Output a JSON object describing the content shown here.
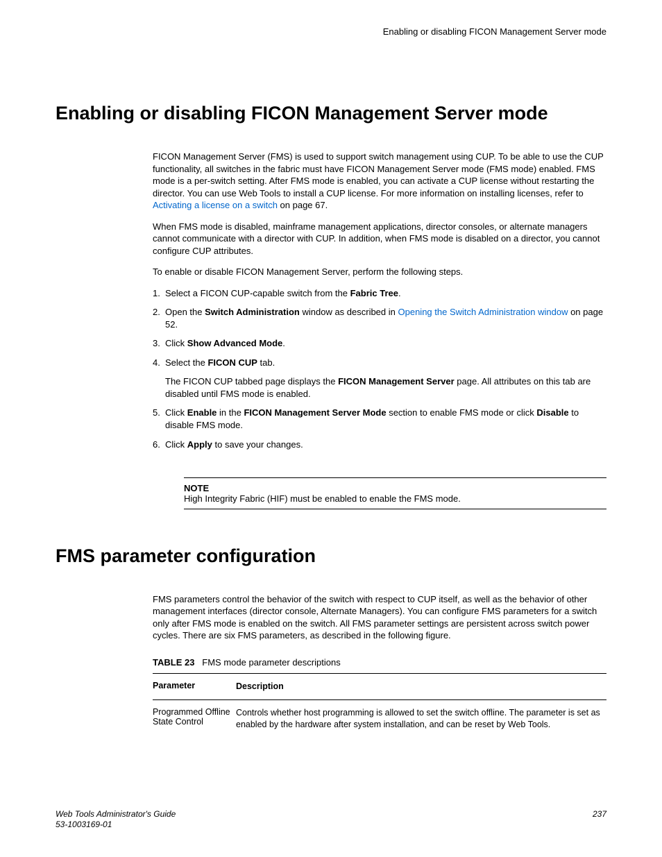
{
  "header": {
    "running_title": "Enabling or disabling FICON Management Server mode"
  },
  "section1": {
    "heading": "Enabling or disabling FICON Management Server mode",
    "para1_before_link": "FICON Management Server (FMS) is used to support switch management using CUP. To be able to use the CUP functionality, all switches in the fabric must have FICON Management Server mode (FMS mode) enabled. FMS mode is a per-switch setting. After FMS mode is enabled, you can activate a CUP license without restarting the director. You can use Web Tools to install a CUP license. For more information on installing licenses, refer to ",
    "para1_link": "Activating a license on a switch",
    "para1_after_link": " on page 67.",
    "para2": "When FMS mode is disabled, mainframe management applications, director consoles, or alternate managers cannot communicate with a director with CUP. In addition, when FMS mode is disabled on a director, you cannot configure CUP attributes.",
    "para3": "To enable or disable FICON Management Server, perform the following steps.",
    "steps": {
      "s1_before": "Select a FICON CUP-capable switch from the ",
      "s1_bold": "Fabric Tree",
      "s1_after": ".",
      "s2_before": "Open the ",
      "s2_bold": "Switch Administration",
      "s2_mid": " window as described in ",
      "s2_link": "Opening the Switch Administration window",
      "s2_after": " on page 52.",
      "s3_before": "Click ",
      "s3_bold": "Show Advanced Mode",
      "s3_after": ".",
      "s4_before": "Select the ",
      "s4_bold": "FICON CUP",
      "s4_after": " tab.",
      "s4_sub_before": "The FICON CUP tabbed page displays the ",
      "s4_sub_bold": "FICON Management Server",
      "s4_sub_after": " page. All attributes on this tab are disabled until FMS mode is enabled.",
      "s5_before": "Click ",
      "s5_bold1": "Enable",
      "s5_mid1": " in the ",
      "s5_bold2": "FICON Management Server Mode",
      "s5_mid2": " section to enable FMS mode or click ",
      "s5_bold3": "Disable",
      "s5_after": " to disable FMS mode.",
      "s6_before": "Click ",
      "s6_bold": "Apply",
      "s6_after": " to save your changes."
    },
    "note": {
      "label": "NOTE",
      "text": "High Integrity Fabric (HIF) must be enabled to enable the FMS mode."
    }
  },
  "section2": {
    "heading": "FMS parameter configuration",
    "para1": "FMS parameters control the behavior of the switch with respect to CUP itself, as well as the behavior of other management interfaces (director console, Alternate Managers). You can configure FMS parameters for a switch only after FMS mode is enabled on the switch. All FMS parameter settings are persistent across switch power cycles. There are six FMS parameters, as described in the following figure.",
    "table": {
      "label_bold": "TABLE 23",
      "label_rest": "FMS mode parameter descriptions",
      "header_col1": "Parameter",
      "header_col2": "Description",
      "row1_col1": "Programmed Offline State Control",
      "row1_col2": "Controls whether host programming is allowed to set the switch offline. The parameter is set as enabled by the hardware after system installation, and can be reset by Web Tools."
    }
  },
  "footer": {
    "guide": "Web Tools Administrator's Guide",
    "docnum": "53-1003169-01",
    "page": "237"
  }
}
